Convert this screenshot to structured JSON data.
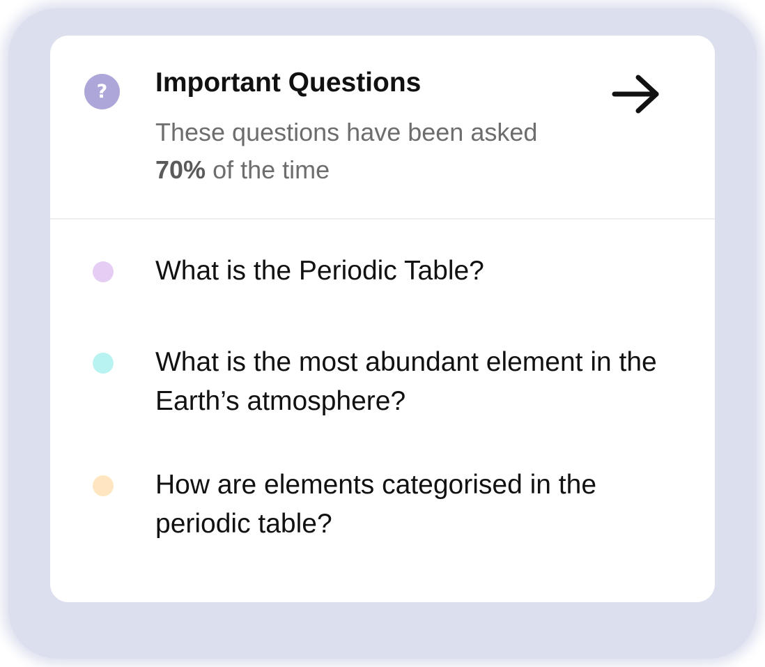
{
  "card": {
    "icon": "question-mark-icon",
    "icon_glyph": "?",
    "icon_color": "#ada6d8",
    "title": "Important Questions",
    "subtitle_main": "These questions have been asked",
    "subtitle_percent": "70%",
    "subtitle_tail": " of the time",
    "action_icon": "arrow-right-icon"
  },
  "questions": [
    {
      "text": "What is the Periodic Table?",
      "dot_color": "#e6cdf3"
    },
    {
      "text": "What is the most abundant element in the Earth’s atmosphere?",
      "dot_color": "#b9f3f1"
    },
    {
      "text": "How are elements categorised in the periodic table?",
      "dot_color": "#ffe6c0"
    }
  ]
}
